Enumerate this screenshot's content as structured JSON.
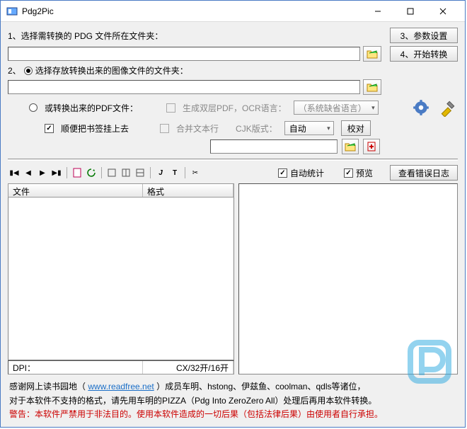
{
  "window": {
    "title": "Pdg2Pic"
  },
  "step1": {
    "label": "1、选择需转换的 PDG 文件所在文件夹："
  },
  "step2": {
    "radio_label": "选择存放转换出来的图像文件的文件夹：",
    "prefix": "2、"
  },
  "step2_alt": {
    "radio_label": "或转换出来的PDF文件："
  },
  "options": {
    "double_pdf": "生成双层PDF，OCR语言：",
    "ocr_lang": "（系统缺省语言）",
    "bookmark": "顺便把书签挂上去",
    "merge_text": "合并文本行",
    "cjk_label": "CJK版式：",
    "cjk_value": "自动",
    "proof": "校对"
  },
  "right_buttons": {
    "params": "3、参数设置",
    "start": "4、开始转换"
  },
  "mid": {
    "auto_stat": "自动统计",
    "preview": "预览",
    "errlog": "查看错误日志"
  },
  "table": {
    "col_file": "文件",
    "col_format": "格式"
  },
  "status": {
    "dpi": "DPI：",
    "cx": "CX/32开/16开"
  },
  "footer": {
    "line1_a": "感谢网上读书园地（",
    "link": "www.readfree.net",
    "line1_b": "）成员车明、hstong、伊兹鱼、coolman、qdls等诸位，",
    "line2": "对于本软件不支持的格式，请先用车明的PIZZA（Pdg Into ZeroZero All）处理后再用本软件转换。",
    "line3": "警告：本软件严禁用于非法目的。使用本软件造成的一切后果（包括法律后果）由使用者自行承担。"
  }
}
